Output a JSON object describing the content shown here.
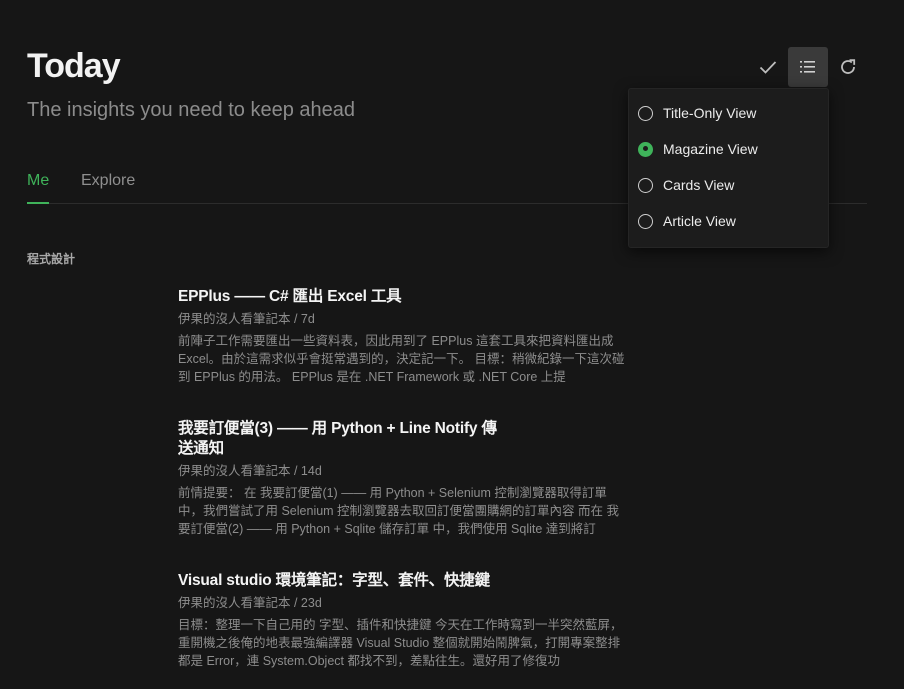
{
  "header": {
    "title": "Today",
    "subtitle": "The insights you need to keep ahead"
  },
  "toolbar": {
    "mark_read_icon": "check-icon",
    "view_icon": "list-view-icon",
    "refresh_icon": "refresh-icon"
  },
  "tabs": [
    {
      "label": "Me",
      "active": true
    },
    {
      "label": "Explore",
      "active": false
    }
  ],
  "section": {
    "label": "程式設計"
  },
  "articles": [
    {
      "title": "EPPlus —— C# 匯出 Excel 工具",
      "meta": "伊果的沒人看筆記本 / 7d",
      "body": "前陣子工作需要匯出一些資料表，因此用到了 EPPlus 這套工具來把資料匯出成 Excel。由於這需求似乎會挺常遇到的，決定記一下。 目標：稍微紀錄一下這次碰到 EPPlus 的用法。 EPPlus 是在 .NET Framework 或 .NET Core 上提"
    },
    {
      "title": "我要訂便當(3) —— 用 Python + Line Notify 傳送通知",
      "meta": "伊果的沒人看筆記本 / 14d",
      "body": "前情提要： 在 我要訂便當(1) —— 用 Python + Selenium 控制瀏覽器取得訂單 中，我們嘗試了用 Selenium 控制瀏覽器去取回訂便當團購網的訂單內容 而在 我要訂便當(2) —— 用 Python + Sqlite 儲存訂單 中，我們使用 Sqlite 達到將訂"
    },
    {
      "title": "Visual studio 環境筆記：字型、套件、快捷鍵",
      "meta": "伊果的沒人看筆記本 / 23d",
      "body": "目標：整理一下自己用的 字型、插件和快捷鍵 今天在工作時寫到一半突然藍屏，重開機之後俺的地表最強編譯器 Visual Studio 整個就開始鬧脾氣，打開專案整排都是 Error，連 System.Object 都找不到，差點往生。還好用了修復功"
    }
  ],
  "view_menu": {
    "options": [
      {
        "label": "Title-Only View",
        "selected": false
      },
      {
        "label": "Magazine View",
        "selected": true
      },
      {
        "label": "Cards View",
        "selected": false
      },
      {
        "label": "Article View",
        "selected": false
      }
    ]
  },
  "colors": {
    "accent": "#3fb35a",
    "background": "#161616"
  }
}
